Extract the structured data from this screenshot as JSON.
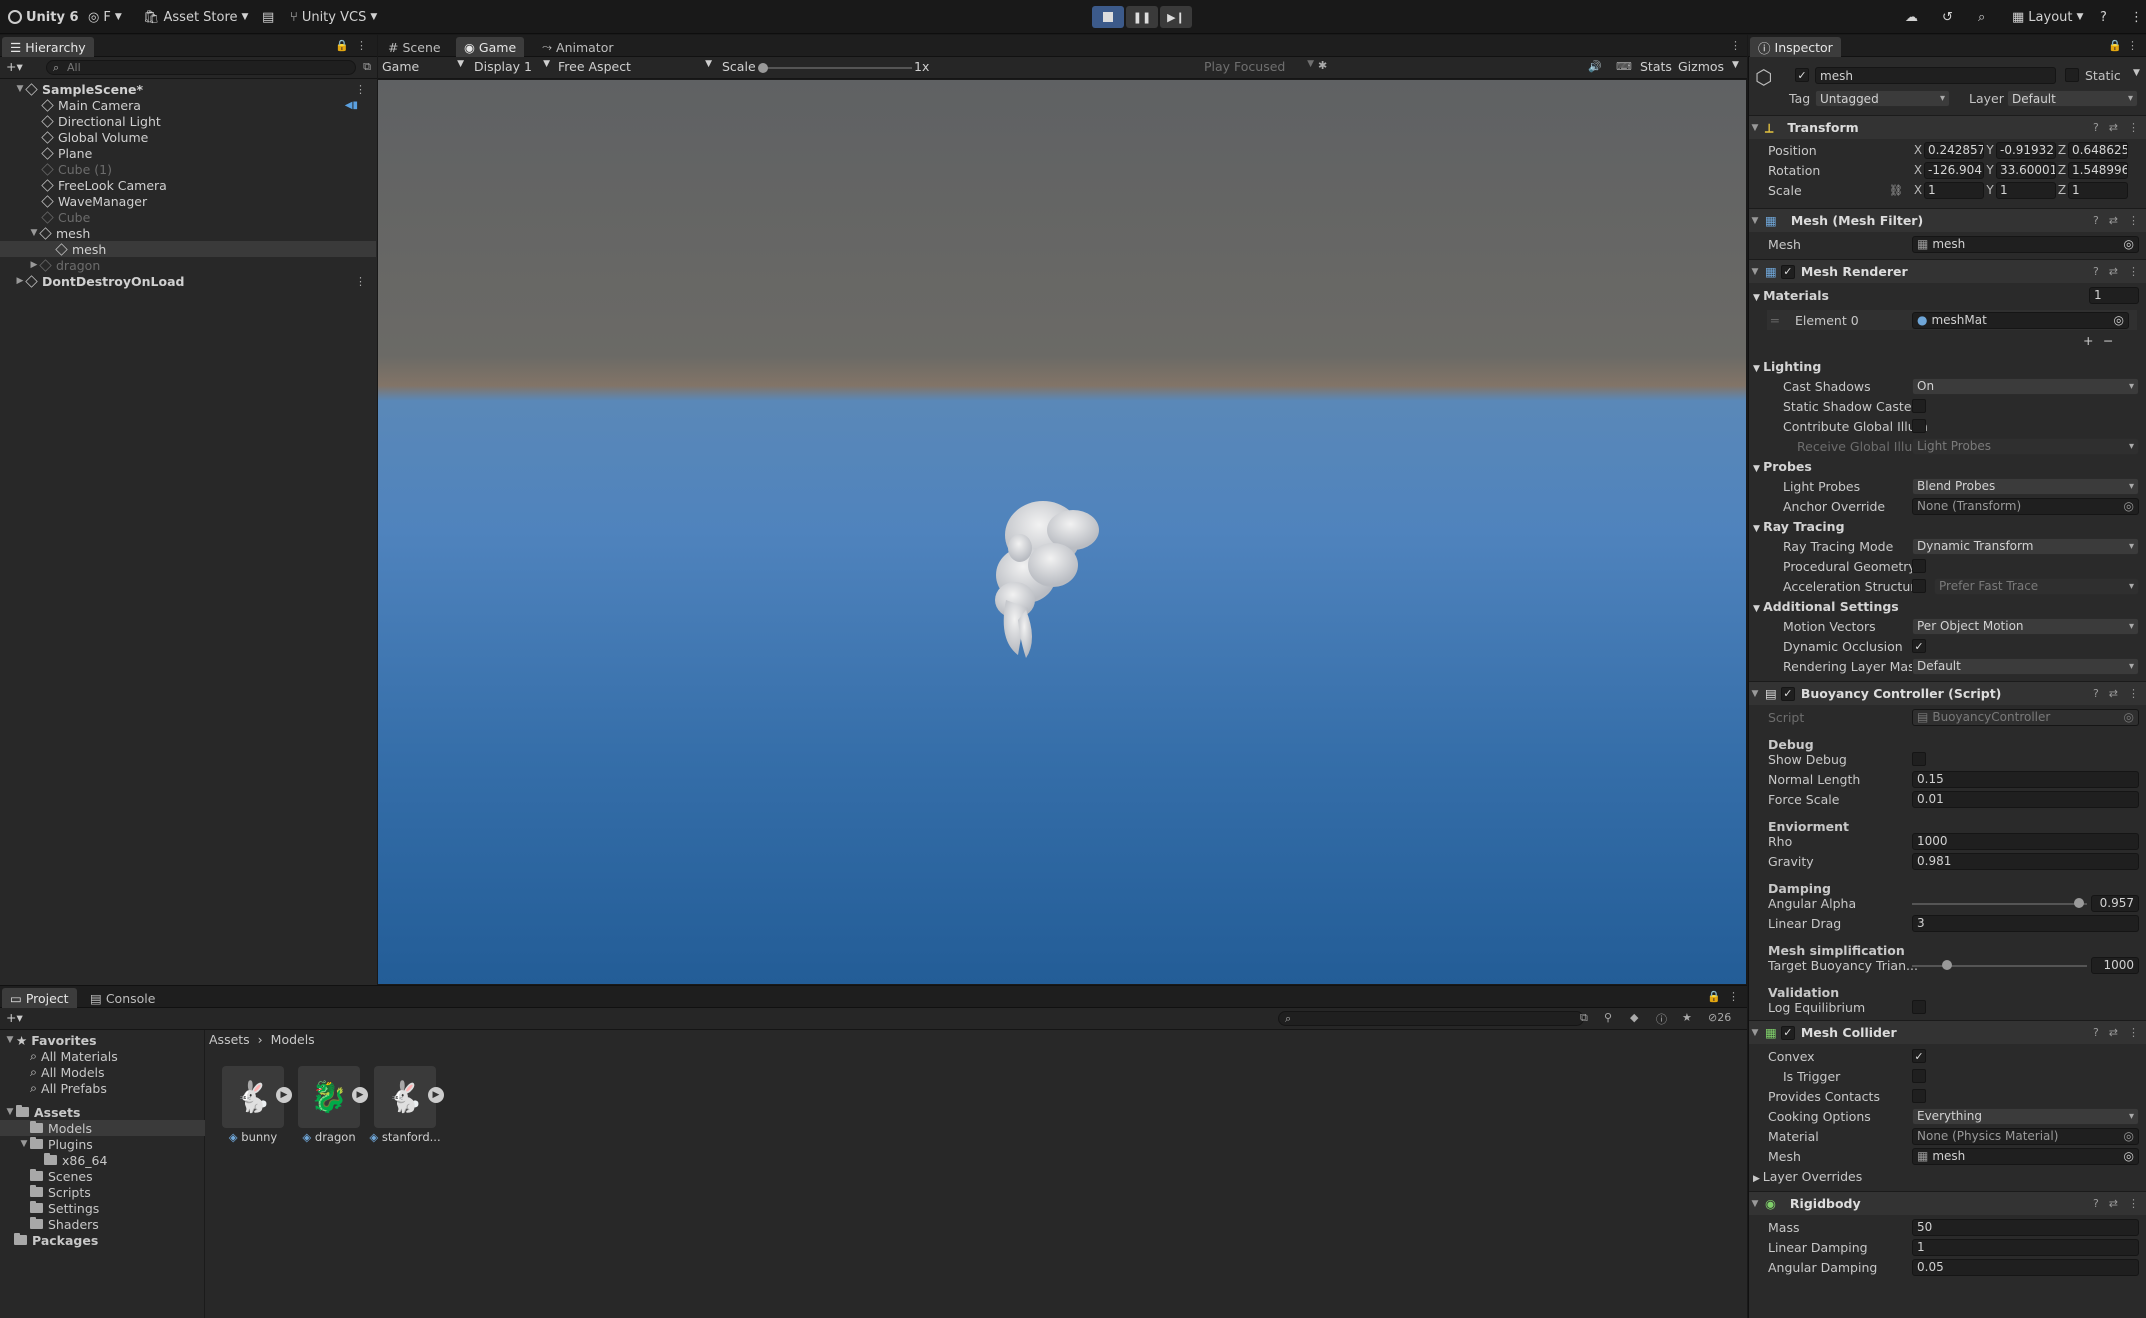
{
  "toolbar": {
    "app_name": "Unity 6",
    "account": "F",
    "asset_store": "Asset Store",
    "vcs": "Unity VCS",
    "layout": "Layout"
  },
  "hierarchy": {
    "tab": "Hierarchy",
    "search_placeholder": "All",
    "rows": [
      {
        "label": "SampleScene*",
        "dim": false
      },
      {
        "label": "Main Camera",
        "dim": false
      },
      {
        "label": "Directional Light",
        "dim": false
      },
      {
        "label": "Global Volume",
        "dim": false
      },
      {
        "label": "Plane",
        "dim": false
      },
      {
        "label": "Cube (1)",
        "dim": true
      },
      {
        "label": "FreeLook Camera",
        "dim": false
      },
      {
        "label": "WaveManager",
        "dim": false
      },
      {
        "label": "Cube",
        "dim": true
      },
      {
        "label": "mesh",
        "dim": false
      },
      {
        "label": "mesh",
        "dim": false
      },
      {
        "label": "dragon",
        "dim": true
      },
      {
        "label": "DontDestroyOnLoad",
        "dim": false
      }
    ]
  },
  "center": {
    "tabs": [
      "Scene",
      "Game",
      "Animator"
    ],
    "game_dropdown": "Game",
    "display": "Display 1",
    "aspect": "Free Aspect",
    "scale_label": "Scale",
    "scale_value": "1x",
    "play_focused": "Play Focused",
    "stats": "Stats",
    "gizmos": "Gizmos"
  },
  "project": {
    "tabs": [
      "Project",
      "Console"
    ],
    "count_badge": "26",
    "breadcrumb": [
      "Assets",
      "Models"
    ],
    "favorites_label": "Favorites",
    "favorites": [
      "All Materials",
      "All Models",
      "All Prefabs"
    ],
    "assets_label": "Assets",
    "tree": [
      "Models",
      "Plugins",
      "x86_64",
      "Scenes",
      "Scripts",
      "Settings",
      "Shaders"
    ],
    "packages_label": "Packages",
    "files": [
      "bunny",
      "dragon",
      "stanford..."
    ]
  },
  "inspector": {
    "tab": "Inspector",
    "object_name": "mesh",
    "static_label": "Static",
    "tag_label": "Tag",
    "tag_value": "Untagged",
    "layer_label": "Layer",
    "layer_value": "Default",
    "transform": {
      "title": "Transform",
      "position_label": "Position",
      "rotation_label": "Rotation",
      "scale_label": "Scale",
      "position": [
        "0.242857",
        "-0.91932",
        "0.648625"
      ],
      "rotation": [
        "-126.904",
        "33.60001",
        "1.548996"
      ],
      "scale": [
        "1",
        "1",
        "1"
      ]
    },
    "mesh_filter": {
      "title": "Mesh (Mesh Filter)",
      "mesh_label": "Mesh",
      "mesh_value": "mesh"
    },
    "mesh_renderer": {
      "title": "Mesh Renderer",
      "materials_label": "Materials",
      "materials_count": "1",
      "element0_label": "Element 0",
      "element0_value": "meshMat",
      "lighting": "Lighting",
      "cast_shadows_label": "Cast Shadows",
      "cast_shadows_value": "On",
      "static_shadow_label": "Static Shadow Caster",
      "contribute_gi_label": "Contribute Global Illum",
      "receive_gi_label": "Receive Global Illum",
      "receive_gi_value": "Light Probes",
      "probes": "Probes",
      "light_probes_label": "Light Probes",
      "light_probes_value": "Blend Probes",
      "anchor_label": "Anchor Override",
      "anchor_value": "None (Transform)",
      "ray_tracing": "Ray Tracing",
      "rt_mode_label": "Ray Tracing Mode",
      "rt_mode_value": "Dynamic Transform",
      "proc_geo_label": "Procedural Geometry",
      "accel_label": "Acceleration Structure",
      "accel_value": "Prefer Fast Trace",
      "additional": "Additional Settings",
      "motion_label": "Motion Vectors",
      "motion_value": "Per Object Motion",
      "dyn_occ_label": "Dynamic Occlusion",
      "render_mask_label": "Rendering Layer Mask",
      "render_mask_value": "Default"
    },
    "buoyancy": {
      "title": "Buoyancy Controller (Script)",
      "script_label": "Script",
      "script_value": "BuoyancyController",
      "debug": "Debug",
      "show_debug_label": "Show Debug",
      "normal_length_label": "Normal Length",
      "normal_length_value": "0.15",
      "force_scale_label": "Force Scale",
      "force_scale_value": "0.01",
      "environment": "Enviorment",
      "rho_label": "Rho",
      "rho_value": "1000",
      "gravity_label": "Gravity",
      "gravity_value": "0.981",
      "damping": "Damping",
      "angular_alpha_label": "Angular Alpha",
      "angular_alpha_value": "0.957",
      "angular_alpha_fraction": 0.957,
      "linear_drag_label": "Linear Drag",
      "linear_drag_value": "3",
      "mesh_simpl": "Mesh simplification",
      "target_label": "Target Buoyancy Trian...",
      "target_value": "1000",
      "target_fraction": 0.2,
      "validation": "Validation",
      "log_eq_label": "Log Equilibrium"
    },
    "mesh_collider": {
      "title": "Mesh Collider",
      "convex_label": "Convex",
      "trigger_label": "Is Trigger",
      "contacts_label": "Provides Contacts",
      "cooking_label": "Cooking Options",
      "cooking_value": "Everything",
      "material_label": "Material",
      "material_value": "None (Physics Material)",
      "mesh_label": "Mesh",
      "mesh_value": "mesh",
      "layer_overrides": "Layer Overrides"
    },
    "rigidbody": {
      "title": "Rigidbody",
      "mass_label": "Mass",
      "mass_value": "50",
      "linear_damping_label": "Linear Damping",
      "linear_damping_value": "1",
      "angular_damping_label": "Angular Damping",
      "angular_damping_value": "0.05"
    }
  }
}
